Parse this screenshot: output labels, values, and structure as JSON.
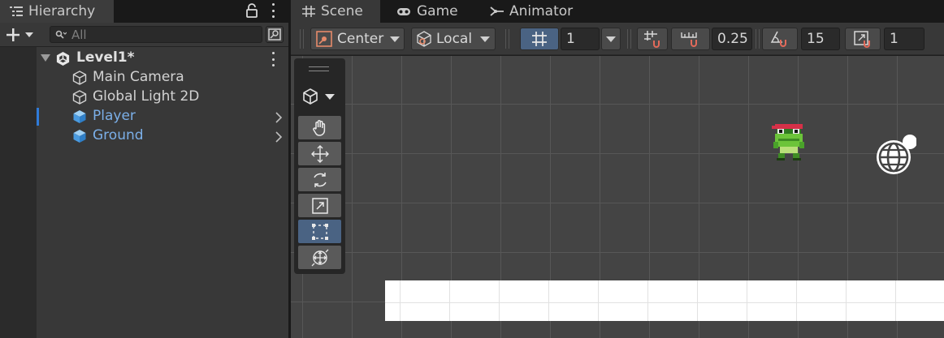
{
  "hierarchy": {
    "tab_label": "Hierarchy",
    "tab_icon": "hierarchy-list-icon",
    "search_placeholder": "All",
    "scene": {
      "name": "Level1*",
      "icon": "unity-scene-icon"
    },
    "objects": [
      {
        "name": "Main Camera",
        "icon": "gameobject-cube-outline-icon",
        "prefab": false,
        "selected": false
      },
      {
        "name": "Global Light 2D",
        "icon": "gameobject-cube-outline-icon",
        "prefab": false,
        "selected": false
      },
      {
        "name": "Player",
        "icon": "prefab-cube-icon",
        "prefab": true,
        "selected": true
      },
      {
        "name": "Ground",
        "icon": "prefab-cube-icon",
        "prefab": true,
        "selected": false
      }
    ]
  },
  "scene_tabs": [
    {
      "label": "Scene",
      "icon": "hash-grid-icon",
      "active": true
    },
    {
      "label": "Game",
      "icon": "gamepad-icon",
      "active": false
    },
    {
      "label": "Animator",
      "icon": "animator-branch-icon",
      "active": false
    }
  ],
  "scene_toolbar": {
    "pivot_mode": "Center",
    "pivot_rotation": "Local",
    "grid_size": "1",
    "snap_increment": "0.25",
    "rotate_snap": "15",
    "scale_snap": "1"
  },
  "tools": [
    {
      "name": "hand-tool",
      "icon": "hand-icon",
      "active": false
    },
    {
      "name": "move-tool",
      "icon": "move-arrows-icon",
      "active": false
    },
    {
      "name": "rotate-tool",
      "icon": "rotate-icon",
      "active": false
    },
    {
      "name": "scale-tool",
      "icon": "scale-icon",
      "active": false
    },
    {
      "name": "rect-tool",
      "icon": "rect-transform-icon",
      "active": true
    },
    {
      "name": "transform-tool",
      "icon": "transform-combo-icon",
      "active": false
    }
  ],
  "colors": {
    "accent_blue": "#4a6383",
    "prefab_text": "#7bafe8",
    "selection_marker": "#2f7bd9",
    "viewport_bg": "#444444"
  }
}
